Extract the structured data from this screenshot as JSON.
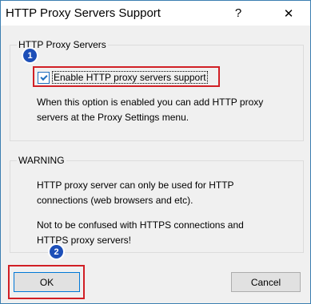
{
  "window": {
    "title": "HTTP Proxy Servers Support",
    "help_glyph": "?",
    "close_glyph": "✕"
  },
  "group_proxy": {
    "title": "HTTP Proxy Servers",
    "checkbox_label": "Enable HTTP proxy servers support",
    "checkbox_checked": true,
    "description_line1": "When this option is enabled you can add HTTP proxy",
    "description_line2": "servers at the Proxy Settings menu."
  },
  "group_warning": {
    "title": "WARNING",
    "line1": "HTTP proxy server can only be used for HTTP",
    "line2": "connections (web browsers and etc).",
    "line3": "Not to be confused with HTTPS connections and",
    "line4": "HTTPS proxy servers!"
  },
  "annotations": {
    "badge1": "1",
    "badge2": "2",
    "highlight_color": "#d11f25",
    "badge_color": "#1d4fb8"
  },
  "buttons": {
    "ok_label": "OK",
    "cancel_label": "Cancel"
  }
}
